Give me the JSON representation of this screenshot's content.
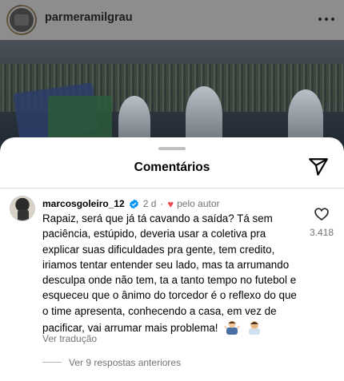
{
  "post": {
    "username": "parmeramilgrau",
    "avatar_icon": "profile-avatar",
    "more_icon": "more-horizontal-icon"
  },
  "sheet": {
    "title": "Comentários",
    "share_icon": "send-icon"
  },
  "comment": {
    "username": "marcosgoleiro_12",
    "verified": true,
    "time": "2 d",
    "separator": "·",
    "liked_by_author": "pelo autor",
    "text": "Rapaiz, será que já tá cavando a saída? Tá sem paciência, estúpido,  deveria usar a coletiva pra explicar suas dificuldades pra gente, tem credito, iriamos tentar entender seu lado, mas ta arrumando desculpa onde não tem, ta a tanto tempo no futebol e esqueceu que o ânimo do torcedor é o reflexo do que o time apresenta, conhecendo a casa, em vez de pacificar, vai arrumar mais problema!",
    "emojis": [
      "man-shrugging-emoji",
      "man-facepalming-emoji"
    ],
    "like_count": "3.418",
    "see_translation": "Ver tradução",
    "view_replies": "Ver 9 respostas anteriores"
  },
  "colors": {
    "heart": "#ed4956",
    "verified": "#0095f6",
    "secondary_text": "#737373"
  }
}
